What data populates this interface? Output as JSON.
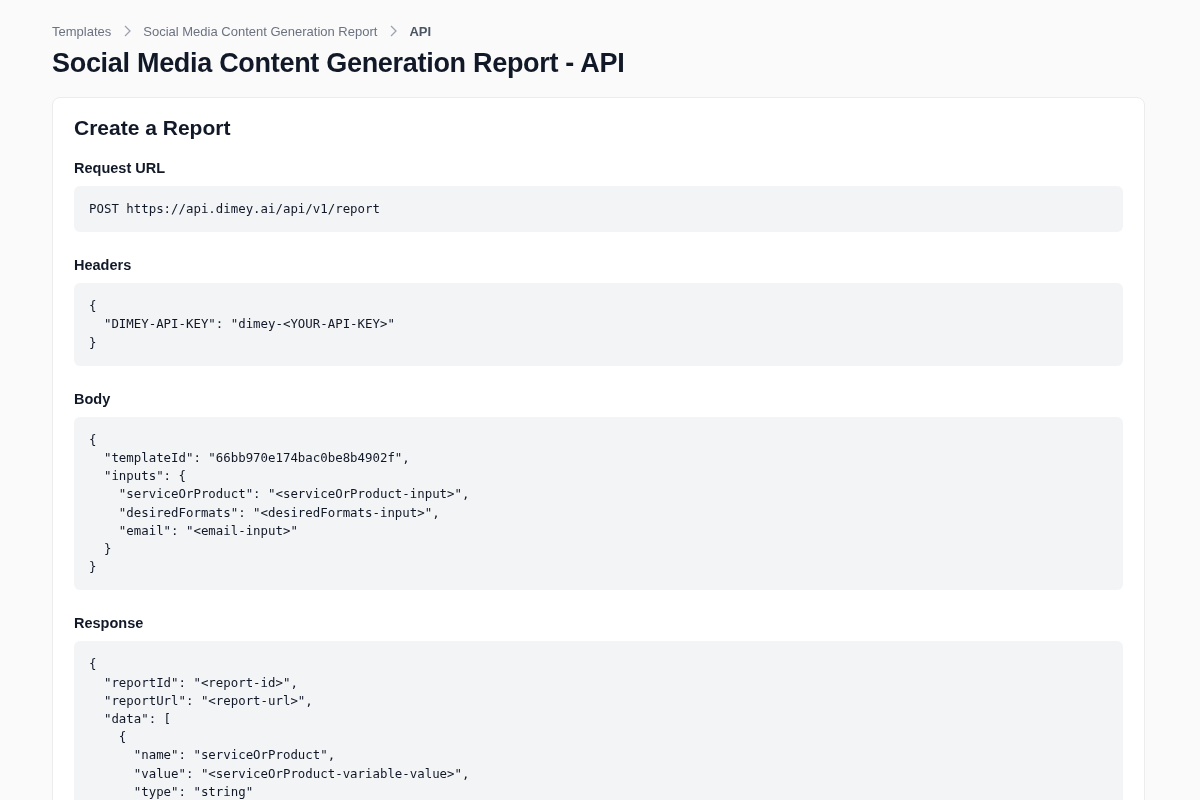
{
  "breadcrumbs": [
    "Templates",
    "Social Media Content Generation Report",
    "API"
  ],
  "page_title": "Social Media Content Generation Report - API",
  "card": {
    "title": "Create a Report",
    "sections": [
      {
        "label": "Request URL",
        "code": "POST https://api.dimey.ai/api/v1/report"
      },
      {
        "label": "Headers",
        "code": "{\n  \"DIMEY-API-KEY\": \"dimey-<YOUR-API-KEY>\"\n}"
      },
      {
        "label": "Body",
        "code": "{\n  \"templateId\": \"66bb970e174bac0be8b4902f\",\n  \"inputs\": {\n    \"serviceOrProduct\": \"<serviceOrProduct-input>\",\n    \"desiredFormats\": \"<desiredFormats-input>\",\n    \"email\": \"<email-input>\"\n  }\n}"
      },
      {
        "label": "Response",
        "code": "{\n  \"reportId\": \"<report-id>\",\n  \"reportUrl\": \"<report-url>\",\n  \"data\": [\n    {\n      \"name\": \"serviceOrProduct\",\n      \"value\": \"<serviceOrProduct-variable-value>\",\n      \"type\": \"string\""
      }
    ]
  }
}
